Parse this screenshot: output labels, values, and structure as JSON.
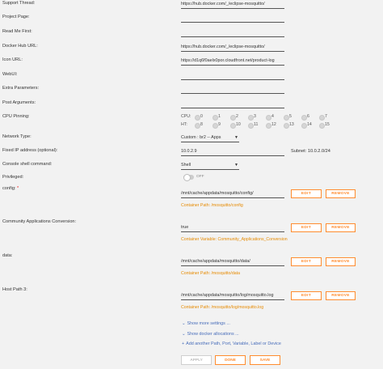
{
  "labels": {
    "support_thread": "Support Thread:",
    "project_page": "Project Page:",
    "read_me_first": "Read Me First:",
    "docker_hub_url": "Docker Hub URL:",
    "icon_url": "Icon URL:",
    "webui": "WebUI:",
    "extra_parameters": "Extra Parameters:",
    "post_arguments": "Post Arguments:",
    "cpu_pinning": "CPU Pinning:",
    "network_type": "Network Type:",
    "fixed_ip": "Fixed IP address (optional):",
    "console_shell": "Console shell command:",
    "privileged": "Privileged:",
    "config": "config:",
    "config_required": "*",
    "community_conversion": "Community Applications Conversion:",
    "data": "data:",
    "host_path_3": "Host Path 3:"
  },
  "values": {
    "support_thread": "https://hub.docker.com/_/eclipse-mosquitto/",
    "project_page": "",
    "read_me_first": "",
    "docker_hub_url": "https://hub.docker.com/_/eclipse-mosquitto/",
    "icon_url": "https://d1q6f0aelx0por.cloudfront.net/product-log",
    "webui": "",
    "extra_parameters": "",
    "post_arguments": "",
    "network_type": "Custom : br2 -- Apps",
    "fixed_ip": "10.0.2.9",
    "subnet": "Subnet: 10.0.2.0/24",
    "console_shell": "Shell",
    "privileged": "OFF",
    "config": "/mnt/cache/appdata/mosquitto/config/",
    "config_sub": "Container Path: /mosquitto/config",
    "community_conversion": "true",
    "community_sub": "Container Variable: Community_Applications_Conversion",
    "data": "/mnt/cache/appdata/mosquitto/data/",
    "data_sub": "Container Path: /mosquitto/data",
    "host_path_3": "/mnt/cache/appdata/mosquitto/log/mosquitto.log",
    "host_path_3_sub": "Container Path: /mosquitto/log/mosquitto.log"
  },
  "cpu": {
    "cpu_label": "CPU:",
    "ht_label": "HT:",
    "cpu_cores": [
      "0",
      "1",
      "2",
      "3",
      "4",
      "5",
      "6",
      "7"
    ],
    "ht_cores": [
      "8",
      "9",
      "10",
      "11",
      "12",
      "13",
      "14",
      "15"
    ]
  },
  "buttons": {
    "edit": "EDIT",
    "remove": "REMOVE",
    "apply": "APPLY",
    "done": "DONE",
    "save": "SAVE"
  },
  "links": {
    "show_more_settings": "Show more settings ...",
    "show_docker_allocations": "Show docker allocations ...",
    "add_another": "Add another Path, Port, Variable, Label or Device"
  },
  "colors": {
    "accent": "#ff8c2f",
    "link": "#486dba",
    "sub_text": "#e68a00"
  }
}
